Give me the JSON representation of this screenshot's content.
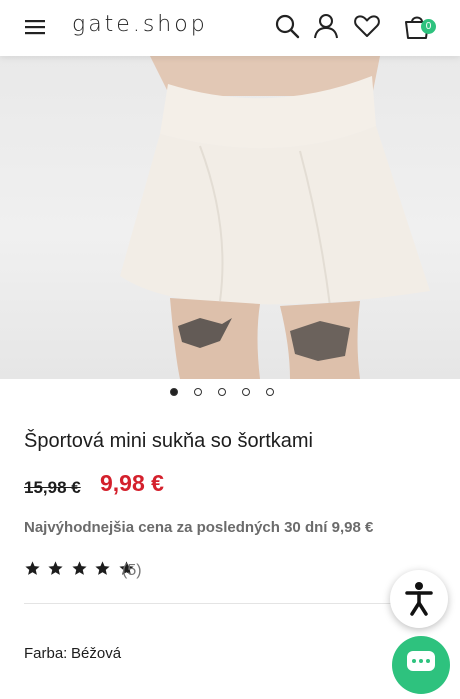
{
  "header": {
    "logo": "gate.shop",
    "cart_count": "0"
  },
  "icons": {
    "menu": "menu-icon",
    "search": "search-icon",
    "account": "user-icon",
    "wishlist": "heart-icon",
    "cart": "shopping-bag-icon",
    "accessibility": "accessibility-icon",
    "chat": "chat-icon"
  },
  "gallery": {
    "image_count": 5,
    "active_index": 0
  },
  "product": {
    "title": "Športová mini sukňa so šortkami",
    "old_price": "15,98 €",
    "price": "9,98 €",
    "lowest_price_note": "Najvýhodnejšia cena za posledných 30 dní 9,98 €",
    "rating": 5,
    "review_count": "(5)",
    "color_label": "Farba:",
    "color_value": "Béžová"
  },
  "colors": {
    "price_red": "#d4202c",
    "badge_green": "#2ec27e"
  }
}
